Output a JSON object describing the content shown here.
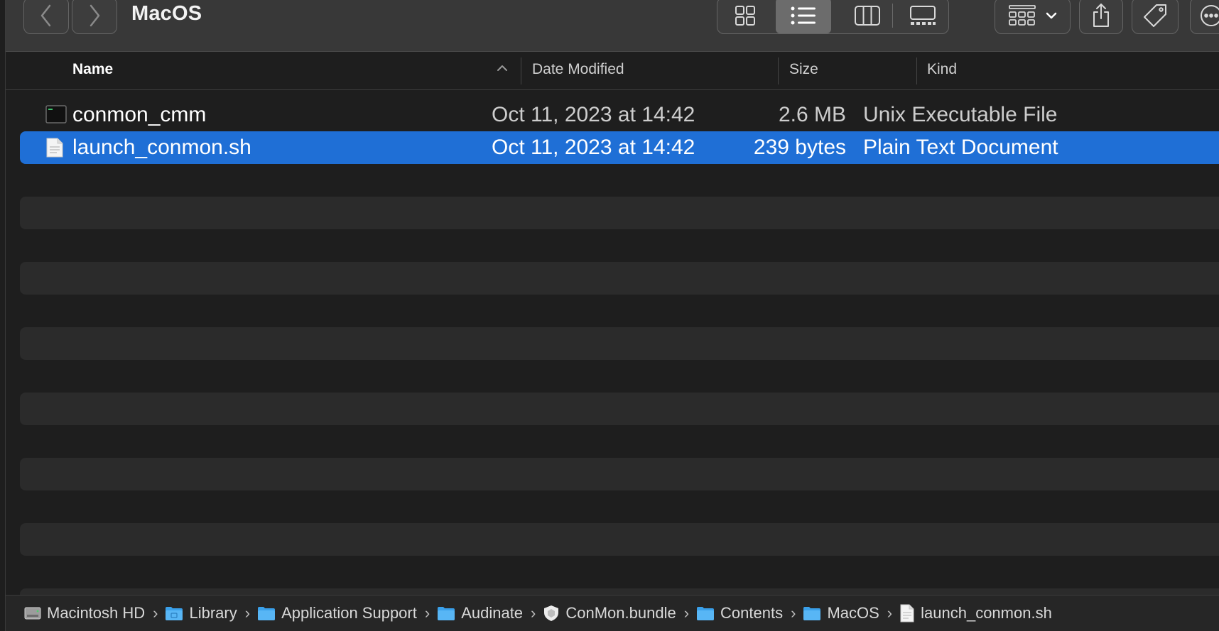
{
  "window": {
    "title": "MacOS"
  },
  "toolbar": {
    "back_icon": "chevron-left-icon",
    "forward_icon": "chevron-right-icon",
    "views": [
      "icon-view",
      "list-view",
      "column-view",
      "gallery-view"
    ],
    "active_view": "list-view",
    "group_icon": "group-by-icon",
    "share_icon": "share-icon",
    "tag_icon": "tag-icon",
    "more_icon": "more-icon"
  },
  "columns": {
    "name": "Name",
    "date_modified": "Date Modified",
    "size": "Size",
    "kind": "Kind",
    "sort_column": "name",
    "sort_direction": "ascending"
  },
  "files": [
    {
      "name": "conmon_cmm",
      "date": "Oct 11, 2023 at 14:42",
      "size": "2.6 MB",
      "kind": "Unix Executable File",
      "icon": "terminal-icon",
      "selected": false
    },
    {
      "name": "launch_conmon.sh",
      "date": "Oct 11, 2023 at 14:42",
      "size": "239 bytes",
      "kind": "Plain Text Document",
      "icon": "document-icon",
      "selected": true
    }
  ],
  "path": [
    {
      "label": "Macintosh HD",
      "icon": "drive-icon"
    },
    {
      "label": "Library",
      "icon": "folder-icon"
    },
    {
      "label": "Application Support",
      "icon": "folder-icon"
    },
    {
      "label": "Audinate",
      "icon": "folder-icon"
    },
    {
      "label": "ConMon.bundle",
      "icon": "bundle-icon"
    },
    {
      "label": "Contents",
      "icon": "folder-icon"
    },
    {
      "label": "MacOS",
      "icon": "folder-icon"
    },
    {
      "label": "launch_conmon.sh",
      "icon": "document-icon"
    }
  ],
  "colors": {
    "selection": "#1f6fd6",
    "folder": "#3aa0ea",
    "background": "#1e1e1e",
    "toolbar": "#383838"
  }
}
